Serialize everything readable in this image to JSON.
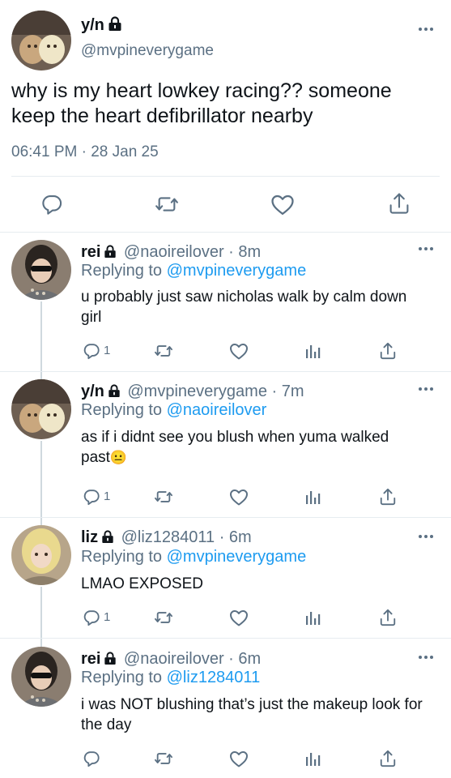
{
  "main_tweet": {
    "name": "y/n",
    "handle": "@mvpineverygame",
    "text": "why is my heart lowkey racing?? someone keep the heart defibrillator nearby",
    "timestamp": "06:41 PM · 28 Jan 25"
  },
  "replies": [
    {
      "name": "rei",
      "meta": "@naoireilover · 8m",
      "replying_prefix": "Replying to ",
      "replying_to": "@mvpineverygame",
      "text": "u probably just saw nicholas walk by calm down girl",
      "reply_count": "1"
    },
    {
      "name": "y/n",
      "meta": "@mvpineverygame · 7m",
      "replying_prefix": "Replying to ",
      "replying_to": "@naoireilover",
      "text": "as if i didnt see you blush when yuma walked past",
      "emoji": "😐",
      "reply_count": "1"
    },
    {
      "name": "liz",
      "meta": "@liz1284011 · 6m",
      "replying_prefix": "Replying to ",
      "replying_to": "@mvpineverygame",
      "text": "LMAO EXPOSED",
      "reply_count": "1"
    },
    {
      "name": "rei",
      "meta": "@naoireilover · 6m",
      "replying_prefix": "Replying to ",
      "replying_to": "@liz1284011",
      "text": "i was NOT blushing that’s just the makeup look for the day",
      "reply_count": ""
    }
  ],
  "colors": {
    "accent": "#1d9bf0",
    "secondary_text": "#5b7083",
    "divider": "#e6ecf0"
  },
  "icons": [
    "lock-icon",
    "more-icon",
    "reply-icon",
    "retweet-icon",
    "like-icon",
    "share-icon",
    "analytics-icon"
  ]
}
